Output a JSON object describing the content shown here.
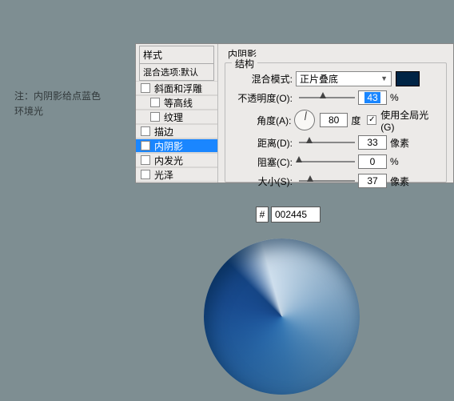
{
  "note": {
    "line1": "注：内阴影给点蓝色",
    "line2": "环境光"
  },
  "sidebar": {
    "header": "样式",
    "sub": "混合选项:默认",
    "items": [
      {
        "label": "斜面和浮雕",
        "checked": false
      },
      {
        "label": "等高线",
        "checked": false
      },
      {
        "label": "纹理",
        "checked": false
      },
      {
        "label": "描边",
        "checked": false
      },
      {
        "label": "内阴影",
        "checked": true,
        "selected": true
      },
      {
        "label": "内发光",
        "checked": false
      },
      {
        "label": "光泽",
        "checked": false
      }
    ]
  },
  "panel": {
    "title": "内阴影",
    "group": "结构",
    "blend": {
      "label": "混合模式:",
      "value": "正片叠底"
    },
    "opacity": {
      "label": "不透明度(O):",
      "value": "43",
      "unit": "%"
    },
    "angle": {
      "label": "角度(A):",
      "value": "80",
      "unit": "度",
      "global_label": "使用全局光(G)"
    },
    "distance": {
      "label": "距离(D):",
      "value": "33",
      "unit": "像素"
    },
    "choke": {
      "label": "阻塞(C):",
      "value": "0",
      "unit": "%"
    },
    "size": {
      "label": "大小(S):",
      "value": "37",
      "unit": "像素"
    }
  },
  "swatch": {
    "hash": "#",
    "hex": "002445"
  }
}
